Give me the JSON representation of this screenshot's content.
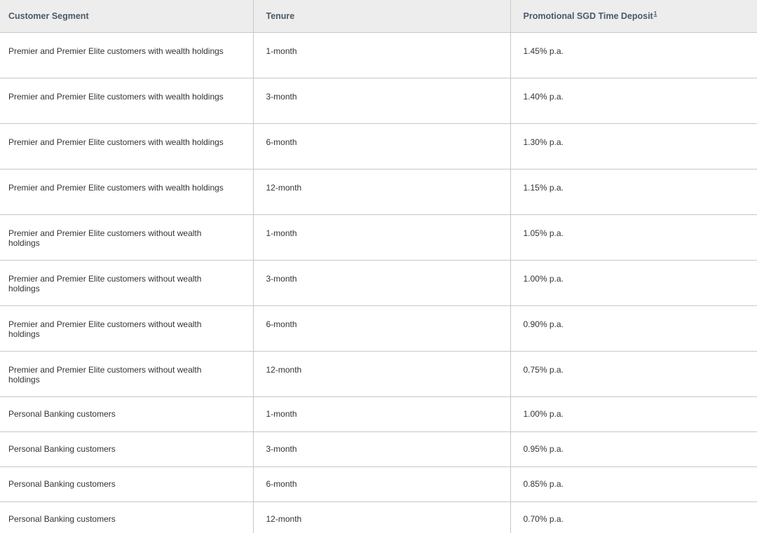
{
  "table": {
    "headers": {
      "segment": "Customer Segment",
      "tenure": "Tenure",
      "rate": "Promotional SGD Time Deposit",
      "rate_footnote": "1"
    },
    "rows": [
      {
        "segment": "Premier and Premier Elite customers with wealth holdings",
        "tenure": "1-month",
        "rate": "1.45% p.a."
      },
      {
        "segment": "Premier and Premier Elite customers with wealth holdings",
        "tenure": "3-month",
        "rate": "1.40% p.a."
      },
      {
        "segment": "Premier and Premier Elite customers with wealth holdings",
        "tenure": "6-month",
        "rate": "1.30% p.a."
      },
      {
        "segment": "Premier and Premier Elite customers with wealth holdings",
        "tenure": "12-month",
        "rate": "1.15% p.a."
      },
      {
        "segment": "Premier and Premier Elite customers without wealth holdings",
        "tenure": "1-month",
        "rate": "1.05% p.a."
      },
      {
        "segment": "Premier and Premier Elite customers without wealth holdings",
        "tenure": "3-month",
        "rate": "1.00% p.a."
      },
      {
        "segment": "Premier and Premier Elite customers without wealth holdings",
        "tenure": "6-month",
        "rate": "0.90% p.a."
      },
      {
        "segment": "Premier and Premier Elite customers without wealth holdings",
        "tenure": "12-month",
        "rate": "0.75% p.a."
      },
      {
        "segment": "Personal Banking customers",
        "tenure": "1-month",
        "rate": "1.00% p.a."
      },
      {
        "segment": "Personal Banking customers",
        "tenure": "3-month",
        "rate": "0.95% p.a."
      },
      {
        "segment": "Personal Banking customers",
        "tenure": "6-month",
        "rate": "0.85% p.a."
      },
      {
        "segment": "Personal Banking customers",
        "tenure": "12-month",
        "rate": "0.70% p.a."
      }
    ]
  }
}
